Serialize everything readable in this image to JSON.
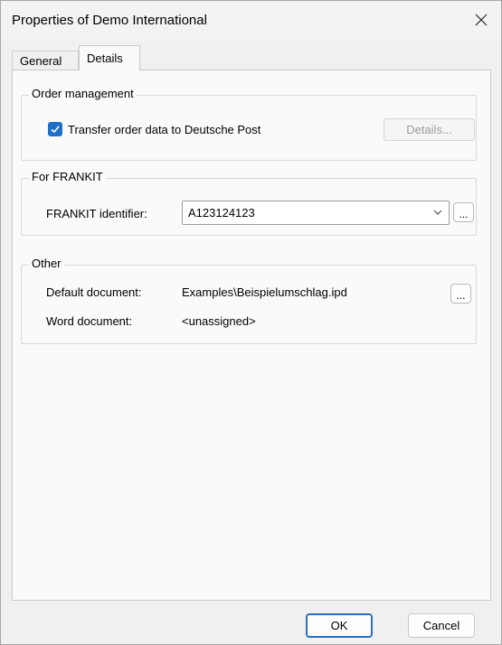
{
  "window": {
    "title": "Properties of Demo International"
  },
  "tabs": [
    {
      "label": "General",
      "active": false
    },
    {
      "label": "Details",
      "active": true
    }
  ],
  "order_management": {
    "legend": "Order management",
    "checkbox_label": "Transfer order data to Deutsche Post",
    "checked": true,
    "details_button": "Details..."
  },
  "frankit": {
    "legend": "For FRANKIT",
    "label": "FRANKIT identifier:",
    "value": "A123124123",
    "browse_button": "..."
  },
  "other": {
    "legend": "Other",
    "default_document_label": "Default document:",
    "default_document_value": "Examples\\Beispielumschlag.ipd",
    "browse_button": "...",
    "word_document_label": "Word document:",
    "word_document_value": "<unassigned>"
  },
  "footer": {
    "ok": "OK",
    "cancel": "Cancel"
  },
  "colors": {
    "accent": "#1f6fc7",
    "ok_border": "#2b6fbf"
  },
  "icons": {
    "close": "close-icon",
    "check": "checkmark-icon",
    "dropdown": "chevron-down-icon"
  }
}
